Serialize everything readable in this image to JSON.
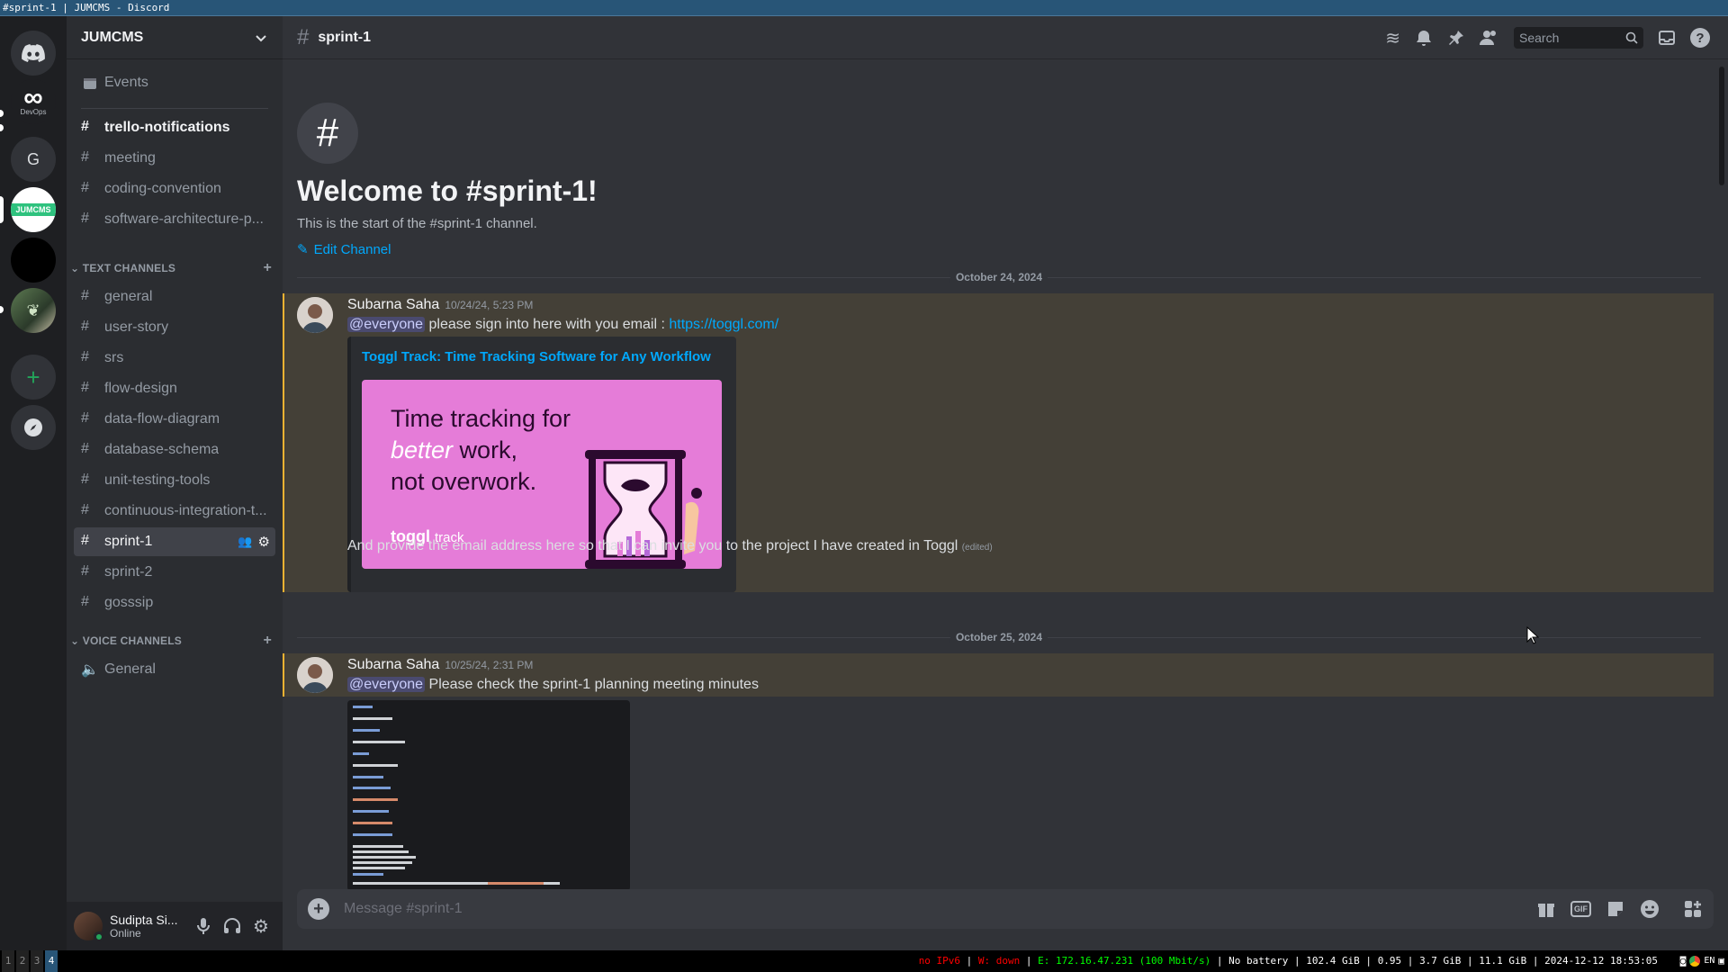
{
  "window": {
    "title": "#sprint-1 | JUMCMS - Discord"
  },
  "servers": [
    {
      "name": "Discord Home",
      "label": ""
    },
    {
      "name": "DevOps",
      "label": "DevOps"
    },
    {
      "name": "G",
      "label": "G"
    },
    {
      "name": "JUMCMS",
      "label": "JUMCMS"
    },
    {
      "name": "Dark server",
      "label": ""
    },
    {
      "name": "Image server",
      "label": ""
    },
    {
      "name": "Add a Server",
      "label": "+"
    },
    {
      "name": "Explore",
      "label": ""
    }
  ],
  "server": {
    "name": "JUMCMS"
  },
  "sidebar": {
    "events_label": "Events",
    "top_channels": [
      "trello-notifications",
      "meeting",
      "coding-convention",
      "software-architecture-p..."
    ],
    "text_category": "TEXT CHANNELS",
    "text_channels": [
      "general",
      "user-story",
      "srs",
      "flow-design",
      "data-flow-diagram",
      "database-schema",
      "unit-testing-tools",
      "continuous-integration-t...",
      "sprint-1",
      "sprint-2",
      "gosssip"
    ],
    "voice_category": "VOICE CHANNELS",
    "voice_channels": [
      "General"
    ]
  },
  "user": {
    "name": "Sudipta Si...",
    "status": "Online"
  },
  "header": {
    "channel": "sprint-1",
    "search_placeholder": "Search"
  },
  "welcome": {
    "title": "Welcome to #sprint-1!",
    "subtitle": "This is the start of the #sprint-1 channel.",
    "edit_label": "Edit Channel"
  },
  "messages": [
    {
      "date_divider": "October 24, 2024",
      "author": "Subarna Saha",
      "timestamp": "10/24/24, 5:23 PM",
      "mention": "@everyone",
      "text": "please sign into here with you email :",
      "link": "https://toggl.com/",
      "embed_title": "Toggl Track: Time Tracking Software for Any Workflow",
      "embed_image": {
        "line1": "Time tracking for",
        "line2_em": "better",
        "line2_rest": " work,",
        "line3": "not overwork.",
        "brand": "toggl",
        "brand2": "track"
      },
      "followup": "And provide the email address here so that I can invite you to the project I have created in Toggl",
      "edited": "(edited)"
    },
    {
      "date_divider": "October 25, 2024",
      "author": "Subarna Saha",
      "timestamp": "10/25/24, 2:31 PM",
      "mention": "@everyone",
      "text": "Please check the sprint-1 planning meeting minutes"
    }
  ],
  "composer": {
    "placeholder": "Message #sprint-1"
  },
  "statusbar": {
    "workspaces": [
      "1",
      "2",
      "3",
      "4"
    ],
    "ipv6": "no IPv6",
    "wifi": "W: down",
    "eth": "E: 172.16.47.231 (100 Mbit/s)",
    "battery": "No battery",
    "disk": "102.4 GiB",
    "load": "0.95",
    "mem": "3.7 GiB",
    "swap": "11.1 GiB",
    "datetime": "2024-12-12 18:53:05",
    "lang": "EN"
  },
  "colors": {
    "accent": "#5865f2",
    "mention_highlight": "#f0b232",
    "link": "#00a8fc",
    "online": "#23a55a",
    "statusbar_red": "#ff0000",
    "statusbar_green": "#00ff00"
  }
}
